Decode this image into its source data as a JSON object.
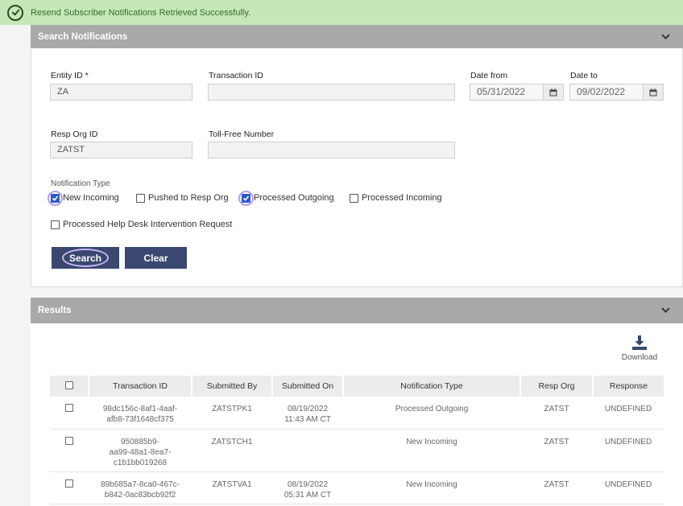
{
  "banner": {
    "message": "Resend Subscriber Notifications Retrieved Successfully.",
    "icon": "check-circle-icon"
  },
  "search_panel": {
    "title": "Search Notifications",
    "fields": {
      "entity_id": {
        "label": "Entity ID *",
        "value": "ZA"
      },
      "transaction_id": {
        "label": "Transaction ID",
        "value": ""
      },
      "date_from": {
        "label": "Date from",
        "value": "05/31/2022"
      },
      "date_to": {
        "label": "Date to",
        "value": "09/02/2022"
      },
      "resp_org_id": {
        "label": "Resp Org ID",
        "value": "ZATST"
      },
      "toll_free_number": {
        "label": "Toll-Free Number",
        "value": ""
      }
    },
    "notification_type": {
      "label": "Notification Type",
      "options": [
        {
          "label": "New Incoming",
          "checked": true
        },
        {
          "label": "Pushed to Resp Org",
          "checked": false
        },
        {
          "label": "Processed Outgoing",
          "checked": true
        },
        {
          "label": "Processed Incoming",
          "checked": false
        },
        {
          "label": "Processed Help Desk Intervention Request",
          "checked": false
        }
      ]
    },
    "buttons": {
      "search": "Search",
      "clear": "Clear"
    }
  },
  "results_panel": {
    "title": "Results",
    "download_label": "Download",
    "columns": [
      "Transaction ID",
      "Submitted By",
      "Submitted On",
      "Notification Type",
      "Resp Org",
      "Response"
    ],
    "rows": [
      {
        "transaction_id": [
          "98dc156c-8af1-4aaf-",
          "afb8-73f1648cf375"
        ],
        "submitted_by": "ZATSTPK1",
        "submitted_on": [
          "08/19/2022",
          "11:43 AM CT"
        ],
        "notification_type": "Processed Outgoing",
        "resp_org": "ZATST",
        "response": "UNDEFINED"
      },
      {
        "transaction_id": [
          "950885b9-",
          "aa99-48a1-8ea7-",
          "c1b1bb019268"
        ],
        "submitted_by": "ZATSTCH1",
        "submitted_on": [
          "",
          ""
        ],
        "notification_type": "New Incoming",
        "resp_org": "ZATST",
        "response": "UNDEFINED"
      },
      {
        "transaction_id": [
          "89b685a7-8ca0-467c-",
          "b842-0ac83bcb92f2"
        ],
        "submitted_by": "ZATSTVA1",
        "submitted_on": [
          "08/19/2022",
          "05:31 AM CT"
        ],
        "notification_type": "New Incoming",
        "resp_org": "ZATST",
        "response": "UNDEFINED"
      }
    ]
  },
  "colors": {
    "banner_bg": "#c5e8b8",
    "header_bg": "#a9a9a9",
    "button_bg": "#3a4770",
    "checkbox_checked": "#2a5ac8"
  }
}
